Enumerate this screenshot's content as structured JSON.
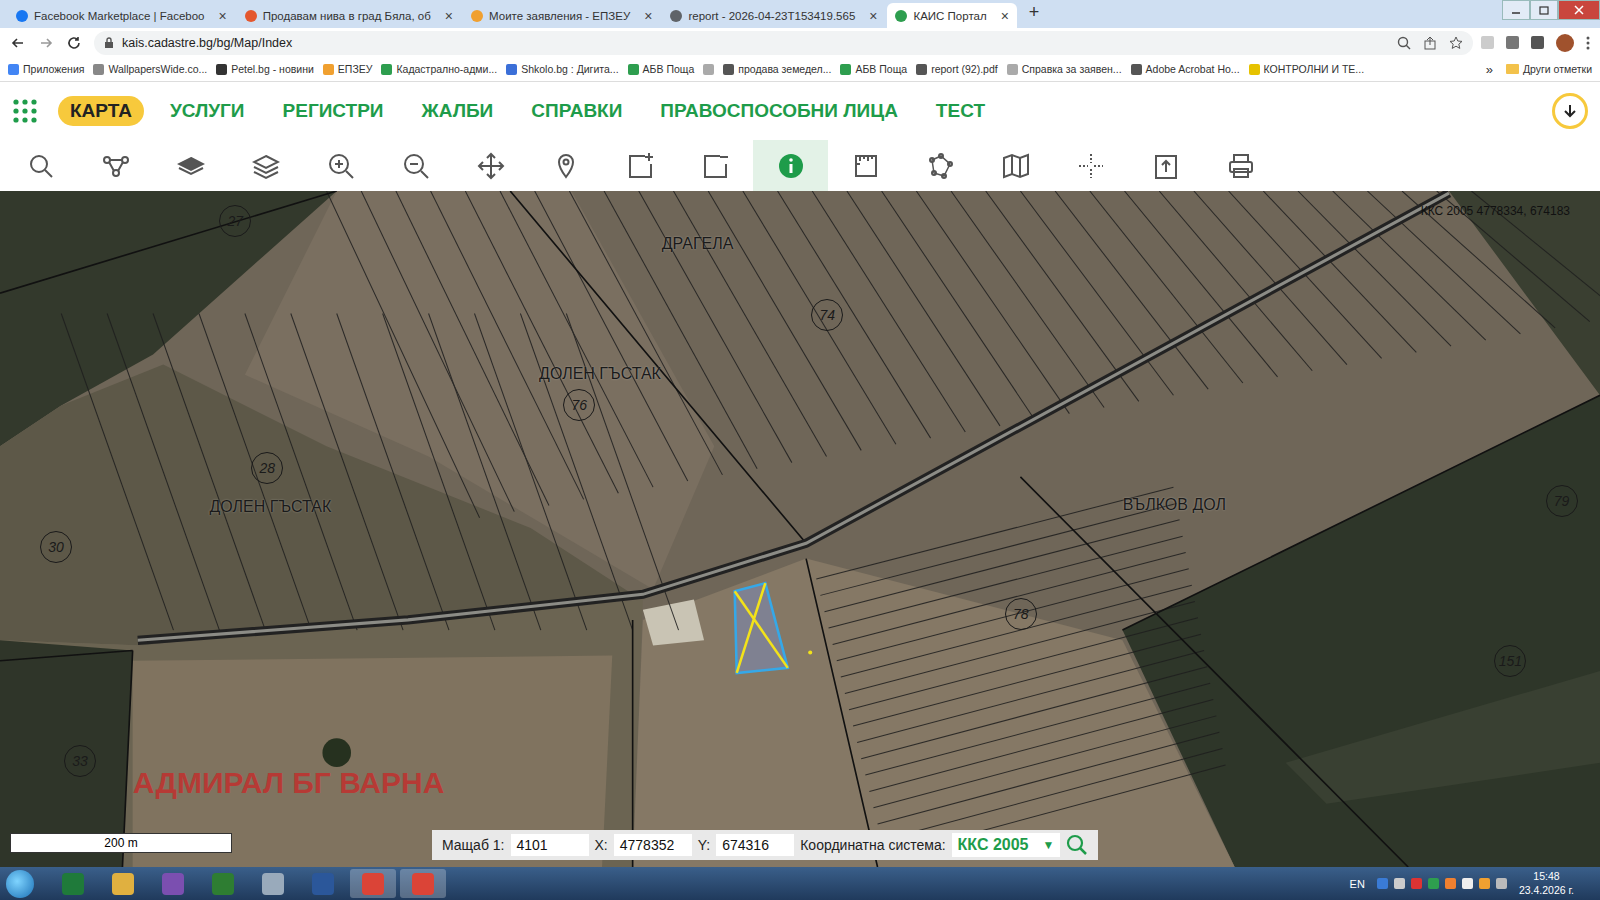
{
  "browser": {
    "tabs": [
      {
        "label": "Facebook Marketplace | Faceboo",
        "selected": false
      },
      {
        "label": "Продавам нива в град Бяла, об",
        "selected": false
      },
      {
        "label": "Моите заявления - ЕПЗЕУ",
        "selected": false
      },
      {
        "label": "report - 2026-04-23T153419.565",
        "selected": false
      },
      {
        "label": "КАИС Портал",
        "selected": true
      }
    ],
    "tab_close": "×",
    "new_tab": "+",
    "address": "kais.cadastre.bg/bg/Map/Index",
    "bookmarks": [
      "Приложения",
      "WallpapersWide.co...",
      "Petel.bg - новини",
      "ЕПЗЕУ",
      "Кадастрално-адми...",
      "Shkolo.bg : Дигита...",
      "АБВ Поща",
      "",
      "продава земедел...",
      "АБВ Поща",
      "report (92).pdf",
      "Справка за заявен...",
      "Adobe Acrobat Ho...",
      "КОНТРОЛНИ И ТЕ..."
    ],
    "more_bookmarks": "»",
    "other_bookmarks": "Други отметки"
  },
  "nav": {
    "items": [
      {
        "label": "КАРТА",
        "selected": true
      },
      {
        "label": "УСЛУГИ",
        "selected": false
      },
      {
        "label": "РЕГИСТРИ",
        "selected": false
      },
      {
        "label": "ЖАЛБИ",
        "selected": false
      },
      {
        "label": "СПРАВКИ",
        "selected": false
      },
      {
        "label": "ПРАВОСПОСОБНИ ЛИЦА",
        "selected": false
      },
      {
        "label": "ТЕСТ",
        "selected": false
      }
    ]
  },
  "toolbar": {
    "tools": [
      {
        "selected": false
      },
      {
        "selected": false
      },
      {
        "selected": false
      },
      {
        "selected": false
      },
      {
        "selected": false
      },
      {
        "selected": false
      },
      {
        "selected": false
      },
      {
        "selected": false
      },
      {
        "selected": false
      },
      {
        "selected": false
      },
      {
        "selected": true
      },
      {
        "selected": false
      },
      {
        "selected": false
      },
      {
        "selected": false
      },
      {
        "selected": false
      },
      {
        "selected": false
      },
      {
        "selected": false
      }
    ]
  },
  "map": {
    "coordinates": "ККС 2005 4778334, 674183",
    "labels": [
      {
        "text": "27",
        "kind": "number"
      },
      {
        "text": "ДРАГЕЛА",
        "kind": "locality"
      },
      {
        "text": "74",
        "kind": "number"
      },
      {
        "text": "ДОЛЕН ГЪСТАК",
        "kind": "locality"
      },
      {
        "text": "76",
        "kind": "number"
      },
      {
        "text": "28",
        "kind": "number"
      },
      {
        "text": "ДОЛЕН ГЪСТАК",
        "kind": "locality"
      },
      {
        "text": "30",
        "kind": "number"
      },
      {
        "text": "ВЪЛКОВ ДОЛ",
        "kind": "locality"
      },
      {
        "text": "78",
        "kind": "number"
      },
      {
        "text": "79",
        "kind": "number"
      },
      {
        "text": "151",
        "kind": "number"
      },
      {
        "text": "33",
        "kind": "number"
      }
    ],
    "watermark": "АДМИРАЛ БГ ВАРНА"
  },
  "status": {
    "scale_bar": "200 m",
    "scale_label": "Мащаб 1:",
    "scale_value": "4101",
    "x_label": "X:",
    "x_value": "4778352",
    "y_label": "Y:",
    "y_value": "674316",
    "crs_label": "Координатна система:",
    "crs_value": "ККС 2005",
    "dropdown": "▼"
  },
  "taskbar": {
    "language": "EN",
    "time": "15:48",
    "date": "23.4.2026 г."
  }
}
